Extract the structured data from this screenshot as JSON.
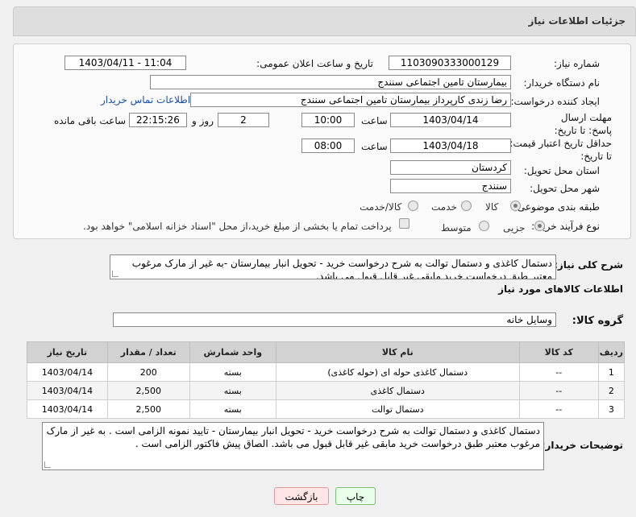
{
  "header": {
    "title": "جزئیات اطلاعات نیاز"
  },
  "form": {
    "need_number_label": "شماره نیاز:",
    "need_number": "1103090333000129",
    "announce_label": "تاریخ و ساعت اعلان عمومی:",
    "announce_value": "1403/04/11 - 11:04",
    "buyer_org_label": "نام دستگاه خریدار:",
    "buyer_org": "بیمارستان تامین اجتماعی سنندج",
    "requester_label": "ایجاد کننده درخواست:",
    "requester": "رضا زندی کارپرداز بیمارستان تامین اجتماعی سنندج",
    "contact_link": "اطلاعات تماس خریدار",
    "deadline_label": "مهلت ارسال پاسخ: تا تاریخ:",
    "deadline_date": "1403/04/14",
    "time_label": "ساعت",
    "deadline_time": "10:00",
    "days_value": "2",
    "days_label": "روز و",
    "remaining_time": "22:15:26",
    "remaining_label": "ساعت باقی مانده",
    "validity_label": "حداقل تاریخ اعتبار قیمت: تا تاریخ:",
    "validity_date": "1403/04/18",
    "validity_time": "08:00",
    "province_label": "استان محل تحویل:",
    "province": "کردستان",
    "city_label": "شهر محل تحویل:",
    "city": "سنندج",
    "category_label": "طبقه بندی موضوعی:",
    "category_options": [
      "کالا",
      "خدمت",
      "کالا/خدمت"
    ],
    "process_label": "نوع فرآیند خرید :",
    "process_options": [
      "جزیی",
      "متوسط"
    ],
    "payment_note": "پرداخت تمام یا بخشی از مبلغ خرید،از محل \"اسناد خزانه اسلامی\" خواهد بود."
  },
  "description": {
    "label": "شرح کلی نیاز:",
    "text": "دستمال کاغذی و دستمال توالت به شرح درخواست خرید - تحویل انبار بیمارستان -به غیر از مارک مرغوب معتبر طبق درخواست خرید مابقی غیر قابل قبول می باشد."
  },
  "goods": {
    "section_title": "اطلاعات کالاهای مورد نیاز",
    "group_label": "گروه کالا:",
    "group_value": "وسایل خانه",
    "columns": [
      "ردیف",
      "کد کالا",
      "نام کالا",
      "واحد شمارش",
      "تعداد / مقدار",
      "تاریخ نیاز"
    ],
    "rows": [
      {
        "idx": "1",
        "code": "--",
        "name": "دستمال کاغذی حوله ای (حوله کاغذی)",
        "unit": "بسته",
        "qty": "200",
        "date": "1403/04/14"
      },
      {
        "idx": "2",
        "code": "--",
        "name": "دستمال کاغذی",
        "unit": "بسته",
        "qty": "2,500",
        "date": "1403/04/14"
      },
      {
        "idx": "3",
        "code": "--",
        "name": "دستمال توالت",
        "unit": "بسته",
        "qty": "2,500",
        "date": "1403/04/14"
      }
    ]
  },
  "buyer_notes": {
    "label": "توضیحات خریدار:",
    "text": "دستمال کاغذی و دستمال توالت به شرح درخواست خرید - تحویل انبار بیمارستان - تایید نمونه الزامی است . به غیر از مارک مرغوب معتبر طبق درخواست خرید مابقی غیر قابل قبول می باشد. الصاق پیش فاکتور الزامی است ."
  },
  "buttons": {
    "print": "چاپ",
    "back": "بازگشت"
  }
}
